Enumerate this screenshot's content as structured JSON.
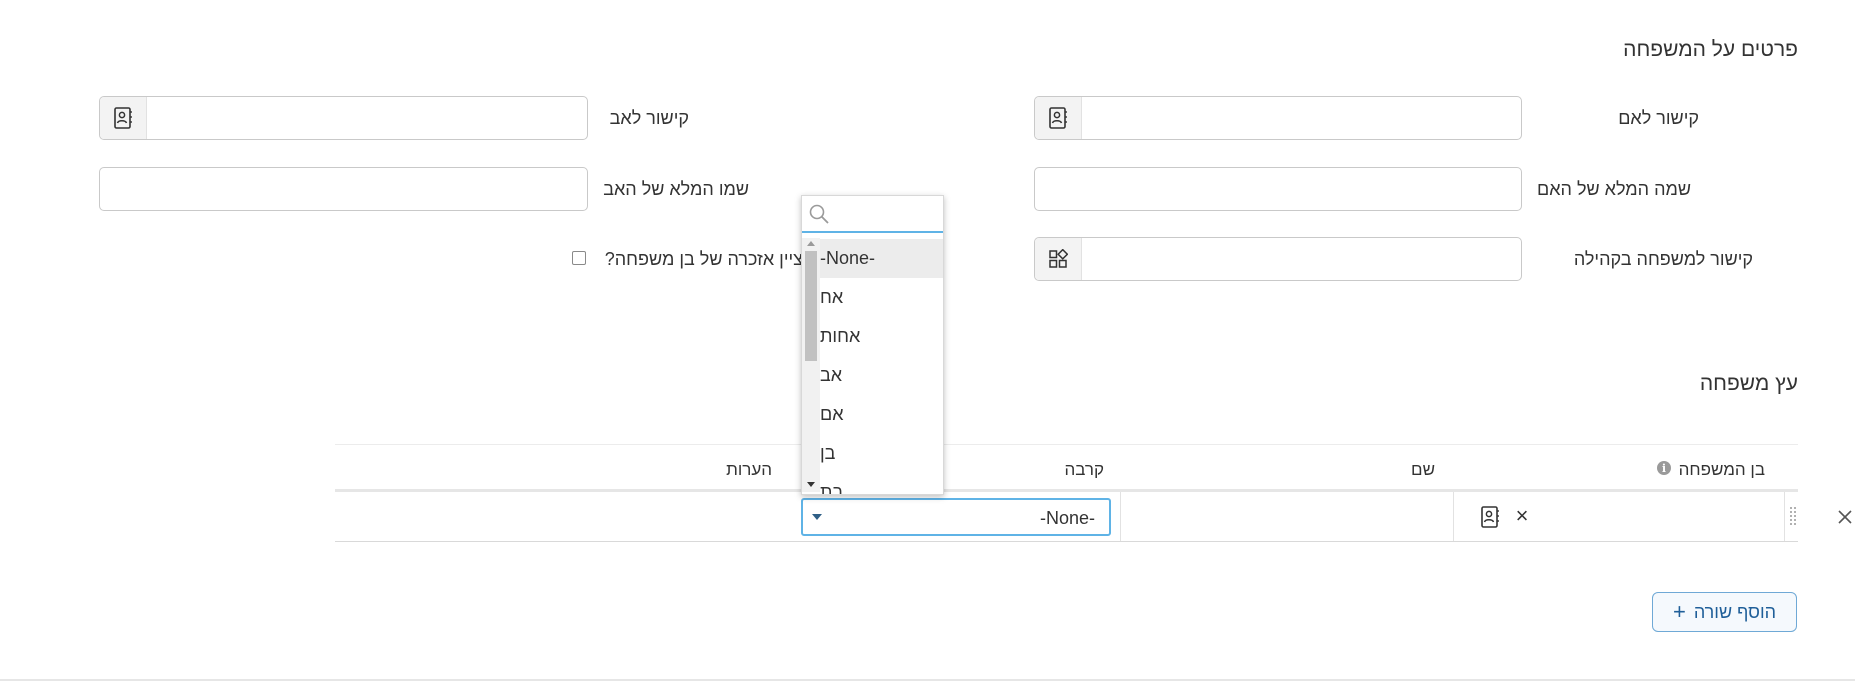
{
  "family_details": {
    "title": "פרטים על המשפחה",
    "mother_link_label": "קישור לאם",
    "father_link_label": "קישור לאב",
    "mother_full_name_label": "שמה המלא של האם",
    "father_full_name_label": "שמו המלא של האב",
    "community_family_link_label": "קישור למשפחה בקהילה",
    "memorial_checkbox_label": "ציין אזכרה של בן משפחה?"
  },
  "family_tree": {
    "title": "עץ משפחה",
    "columns": {
      "member": "בן המשפחה",
      "name": "שם",
      "relation": "קרבה",
      "notes": "הערות"
    },
    "row": {
      "relation_value": "-None-"
    },
    "add_row_label": "הוסף שורה",
    "add_row_icon": "+",
    "remove_icon": "×"
  },
  "relation_dropdown": {
    "search_placeholder": "",
    "options": [
      "-None-",
      "אח",
      "אחות",
      "אב",
      "אם",
      "בן",
      "בת"
    ],
    "selected": "-None-"
  },
  "colors": {
    "accent": "#5fb3e6",
    "button_text": "#1f5f99"
  }
}
